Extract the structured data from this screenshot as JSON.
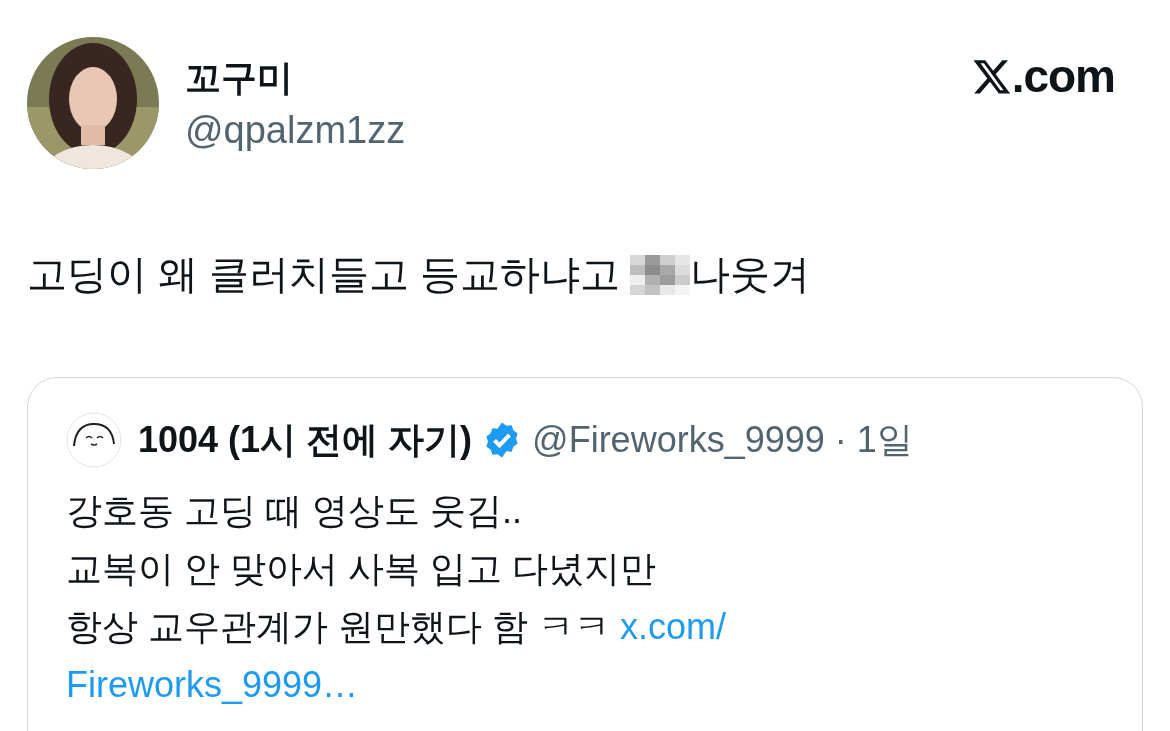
{
  "author": {
    "name": "꼬구미",
    "handle": "@qpalzm1zz"
  },
  "brand": {
    "suffix": ".com"
  },
  "tweet": {
    "text_before": "고딩이 왜 클러치들고 등교하냐고",
    "censored": true,
    "text_after": "나웃겨"
  },
  "quote": {
    "name": "1004 (1시 전에 자기)",
    "verified": true,
    "handle": "@Fireworks_9999",
    "separator": "·",
    "time": "1일",
    "lines": [
      "강호동 고딩 때 영상도 웃김..",
      "교복이 안 맞아서 사복 입고 다녔지만",
      "항상 교우관계가 원만했다 함 ㅋㅋ"
    ],
    "link_lines": [
      "x.com/",
      "Fireworks_9999…"
    ]
  }
}
